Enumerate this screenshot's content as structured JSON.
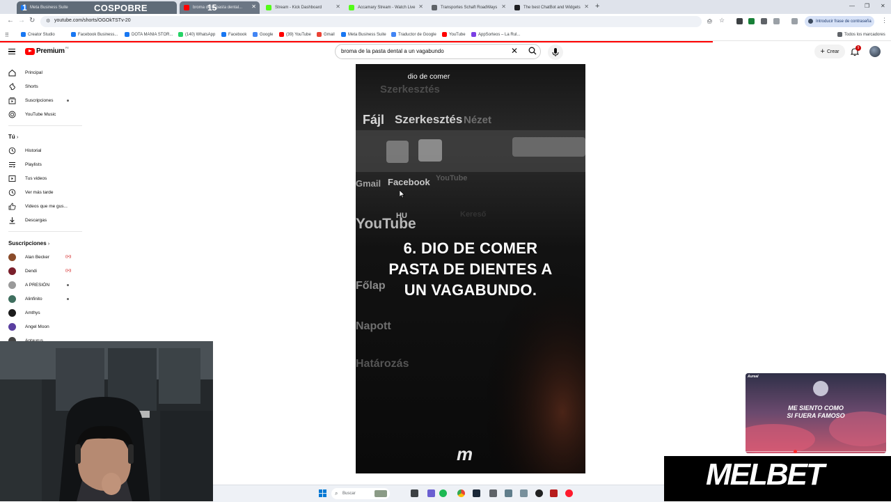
{
  "browser": {
    "tabs": [
      {
        "label": "Meta Business Suite",
        "color": "#1877f2",
        "state": "overlay"
      },
      {
        "label": "broma de la pasta dental...",
        "color": "#ff0000",
        "state": "overlay"
      },
      {
        "label": "Stream - Kick Dashboard",
        "color": "#53fc18",
        "state": "normal"
      },
      {
        "label": "Accamary Stream - Watch Live",
        "color": "#53fc18",
        "state": "normal"
      },
      {
        "label": "Transportes Schaft RoadWays",
        "color": "#5f6368",
        "state": "normal"
      },
      {
        "label": "The best ChatBot and Widgets",
        "color": "#202124",
        "state": "normal"
      }
    ],
    "overlay_numbers": [
      "1",
      "15"
    ],
    "overlay_brand": "COSPOBRE",
    "url": "youtube.com/shorts/OGOkTSTv-20",
    "password_prompt": "Introducir frase de contraseña",
    "bookmarks": [
      {
        "label": "Creator Studio",
        "color": "#1877f2"
      },
      {
        "label": "Facebook Business...",
        "color": "#1877f2"
      },
      {
        "label": "DOTA MANIA STOR...",
        "color": "#1877f2"
      },
      {
        "label": "(140) WhatsApp",
        "color": "#25d366"
      },
      {
        "label": "Facebook",
        "color": "#1877f2"
      },
      {
        "label": "Google",
        "color": "#4285f4"
      },
      {
        "label": "(39) YouTube",
        "color": "#ff0000"
      },
      {
        "label": "Gmail",
        "color": "#ea4335"
      },
      {
        "label": "Meta Business Suite",
        "color": "#1877f2"
      },
      {
        "label": "Traductor de Google",
        "color": "#4285f4"
      },
      {
        "label": "YouTube",
        "color": "#ff0000"
      },
      {
        "label": "AppSorteos – La Rul...",
        "color": "#7b3fe4"
      }
    ],
    "all_bookmarks": "Todos los marcadores"
  },
  "youtube": {
    "logo_text": "Premium",
    "country_code": "PE",
    "search_query": "broma de la pasta dental a un vagabundo",
    "create_label": "Crear",
    "notification_count": "9"
  },
  "sidebar": {
    "main": [
      {
        "label": "Principal",
        "icon": "home-icon"
      },
      {
        "label": "Shorts",
        "icon": "shorts-icon"
      },
      {
        "label": "Suscripciones",
        "icon": "subscriptions-icon"
      },
      {
        "label": "YouTube Music",
        "icon": "music-icon"
      }
    ],
    "you_heading": "Tú",
    "you": [
      {
        "label": "Historial",
        "icon": "history-icon"
      },
      {
        "label": "Playlists",
        "icon": "playlists-icon"
      },
      {
        "label": "Tus videos",
        "icon": "your-videos-icon"
      },
      {
        "label": "Ver más tarde",
        "icon": "watch-later-icon"
      },
      {
        "label": "Videos que me gus...",
        "icon": "liked-icon"
      },
      {
        "label": "Descargas",
        "icon": "downloads-icon"
      }
    ],
    "subs_heading": "Suscripciones",
    "subscriptions": [
      {
        "label": "Alan Becker",
        "status": "live",
        "color": "#8a4b2a"
      },
      {
        "label": "Dendi",
        "status": "live",
        "color": "#7a1f2b"
      },
      {
        "label": "A PRESIÓN",
        "status": "dot",
        "color": "#9a9a9a"
      },
      {
        "label": "Alinfinito",
        "status": "dot",
        "color": "#3f6f5f"
      },
      {
        "label": "Amthys",
        "status": "",
        "color": "#1c1c1c"
      },
      {
        "label": "Angel Moon",
        "status": "",
        "color": "#5a3fa0"
      },
      {
        "label": "Antaurus",
        "status": "",
        "color": "#444444"
      }
    ]
  },
  "video": {
    "caption": "dio de comer",
    "title_lines": [
      "6. DIO DE COMER",
      "PASTA DE DIENTES A",
      "UN VAGABUNDO."
    ],
    "bg_words": [
      "Fájl",
      "Szerkesztés",
      "Nézet",
      "Szerkesztés",
      "Gmail",
      "Facebook",
      "YouTube",
      "YouTube",
      "HU",
      "Kereső",
      "Főlap",
      "Napott",
      "Határozás"
    ],
    "logo": "m"
  },
  "ad": {
    "brand": "Aureal",
    "lines": [
      "ME SIENTO COMO",
      "SI FUERA FAMOSO"
    ],
    "sponsor": "MELBET"
  },
  "taskbar": {
    "search_placeholder": "Buscar"
  }
}
